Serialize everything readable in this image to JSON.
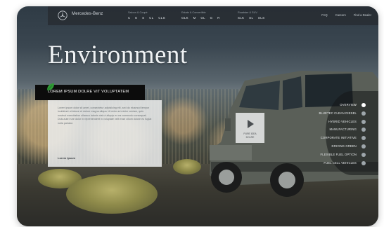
{
  "brand": {
    "name": "Mercedes-Benz"
  },
  "nav": {
    "groups": [
      {
        "title": "Saloon & Coupé",
        "models": [
          "C",
          "E",
          "S",
          "CL",
          "CLS"
        ]
      },
      {
        "title": "Estate & Convertible",
        "models": [
          "GLK",
          "M",
          "GL",
          "G",
          "R"
        ]
      },
      {
        "title": "Roadster & SUV",
        "models": [
          "SLK",
          "SL",
          "SLS"
        ]
      }
    ],
    "links": [
      "FAQ",
      "Careers",
      "Find a Dealer"
    ]
  },
  "page": {
    "title": "Environment"
  },
  "panel": {
    "heading": "LOREM IPSUM DOLRE VIT VOLUPTATEM",
    "body": "Lorem ipsum dolor sit amet, consectetur adipisicing elit, sed do eiusmod tempor incididunt ut labore et dolore magna aliqua. Ut enim ad minim veniam, quis nostrud exercitation ullamco laboris nisi ut aliquip ex ea commodo consequat. Duis aute irure dolor in reprehenderit in voluptate velit esse cillum dolore eu fugiat nulla pariatur.",
    "link": "Lorem Ipsum"
  },
  "video": {
    "label_line1": "PURE IDEA",
    "label_line2": "DOLRE"
  },
  "menu": {
    "items": [
      {
        "label": "OVERVIEW",
        "active": true
      },
      {
        "label": "BLUETEC CLEAN DIESEL",
        "active": false
      },
      {
        "label": "HYBRID VEHICLES",
        "active": false
      },
      {
        "label": "MANUFACTURING",
        "active": false
      },
      {
        "label": "CORPORATE INITIATIVE",
        "active": false
      },
      {
        "label": "DRIVING GREEN",
        "active": false
      },
      {
        "label": "FLEXIBLE FUEL OPTION",
        "active": false
      },
      {
        "label": "FUEL CELL VEHICLES",
        "active": false
      }
    ]
  },
  "icons": {
    "logo": "mercedes-star-icon",
    "leaf": "leaf-icon",
    "play": "play-icon"
  },
  "colors": {
    "panel_head": "#0c0c0c",
    "leaf": "#2f9a35",
    "text_light": "#eef1f3"
  }
}
